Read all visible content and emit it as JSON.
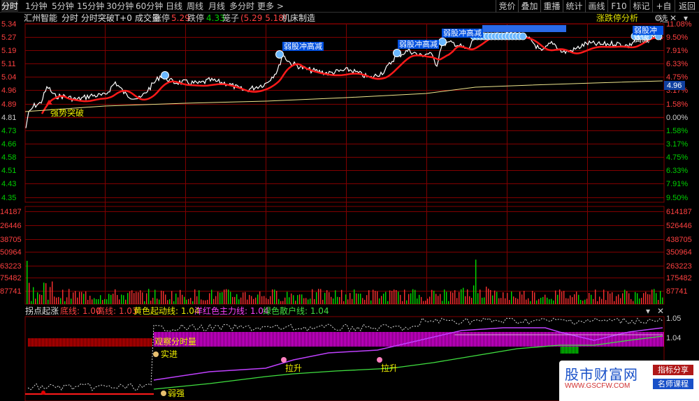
{
  "topbar": {
    "tabs": [
      "分时",
      "1分钟",
      "5分钟",
      "15分钟",
      "30分钟",
      "60分钟",
      "日线",
      "周线",
      "月线",
      "多分时",
      "更多 >"
    ],
    "active_tab": "分时",
    "buttons": [
      "竞价",
      "叠加",
      "重播",
      "统计",
      "画线",
      "F10",
      "标记",
      "+自选",
      "返回"
    ]
  },
  "infobar": {
    "stock_name": "汇州智能",
    "indicator_name": "分时 分时突破T+0",
    "volume_label": "成交量",
    "limit_up_label": "涨停",
    "limit_up_value": "5.29",
    "limit_down_label": "跌停",
    "limit_down_value": "4.33",
    "cage_label": "笼子",
    "cage_value": "(5.29 5.18)",
    "tag": "机床制造",
    "analysis_button": "涨跌停分析"
  },
  "price_axis": {
    "left": [
      "5.34",
      "5.27",
      "5.19",
      "5.11",
      "5.04",
      "4.96",
      "4.89",
      "4.81",
      "4.73",
      "4.66",
      "4.58",
      "4.51",
      "4.43",
      "4.35"
    ],
    "right": [
      "11.08%",
      "9.50%",
      "7.91%",
      "6.33%",
      "4.75%",
      "3.17%",
      "1.58%",
      "0.00%",
      "1.58%",
      "3.17%",
      "4.75%",
      "6.33%",
      "7.91%",
      "9.50%"
    ],
    "current_price": "4.96"
  },
  "volume_axis": {
    "left": [
      "14187",
      "26446",
      "38705",
      "50964",
      "63223",
      "75482",
      "87741"
    ],
    "right": [
      "614187",
      "526446",
      "438705",
      "350964",
      "263223",
      "175482",
      "87741"
    ]
  },
  "annotations": {
    "strong_breakout": "强势突破",
    "weak_high_1": "弱股冲高减",
    "weak_high_2": "弱股冲高减",
    "weak_high_3": "弱股冲高减",
    "weak_high_4": "弱股冲高减"
  },
  "indicator_panel": {
    "name": "拐点起涨",
    "bottom_line": "底线: 1.00",
    "top_line": "高线: 1.03",
    "yellow_line": "黄色起动线: 1.04",
    "magenta_line": "洋红色主力线: 1.04",
    "green_line": "绿色散户线: 1.04",
    "axis_top": "1.05",
    "axis_mid": "1.04",
    "observe_label": "观察分时量",
    "buy_label": "实进",
    "lift_label_1": "拉升",
    "lift_label_2": "拉升",
    "weak_label": "弱强"
  },
  "watermark": {
    "title": "股市财富网",
    "url": "WWW.GSCFW.COM",
    "chip_1": "指标分享",
    "chip_2": "名师课程"
  },
  "colors": {
    "price_line": "#ffffff",
    "avg_line": "#f0e68c",
    "ma_line": "#ff1a1a",
    "up_volume": "#ff3030",
    "down_volume": "#00e000",
    "magenta": "#ff00ff",
    "grid": "#800000",
    "positive_axis": "#ff4040",
    "negative_axis": "#00d000"
  }
}
